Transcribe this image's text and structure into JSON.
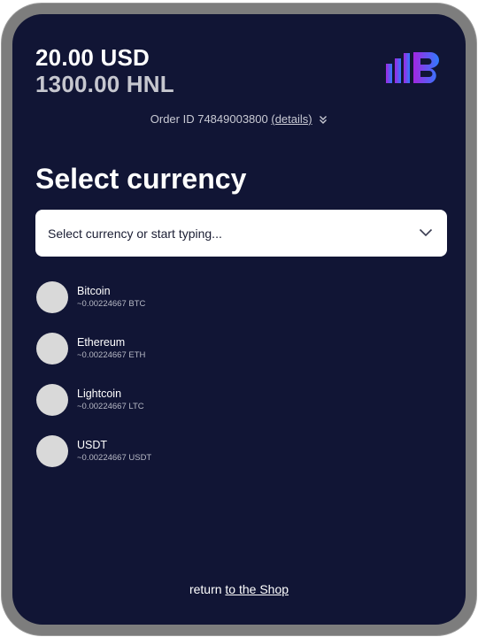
{
  "header": {
    "amount_primary": "20.00 USD",
    "amount_secondary": "1300.00 HNL",
    "logo_icon": "brand-logo-icon"
  },
  "order": {
    "prefix": "Order ID",
    "id": "74849003800",
    "details_label": "(details)",
    "expand_icon": "double-chevron-down-icon"
  },
  "main": {
    "title": "Select currency",
    "select": {
      "placeholder": "Select currency or start typing...",
      "arrow_icon": "chevron-down-icon"
    },
    "currencies": [
      {
        "name": "Bitcoin",
        "rate": "~0.00224667 BTC"
      },
      {
        "name": "Ethereum",
        "rate": "~0.00224667 ETH"
      },
      {
        "name": "Lightcoin",
        "rate": "~0.00224667 LTC"
      },
      {
        "name": "USDT",
        "rate": "~0.00224667 USDT"
      }
    ]
  },
  "footer": {
    "prefix": "return",
    "link_label": "to the Shop"
  },
  "colors": {
    "background": "#111535",
    "frame": "#7d7d7d",
    "coin_placeholder": "#d9d9d9",
    "logo_gradient_start": "#a326e0",
    "logo_gradient_end": "#2f7bff"
  }
}
